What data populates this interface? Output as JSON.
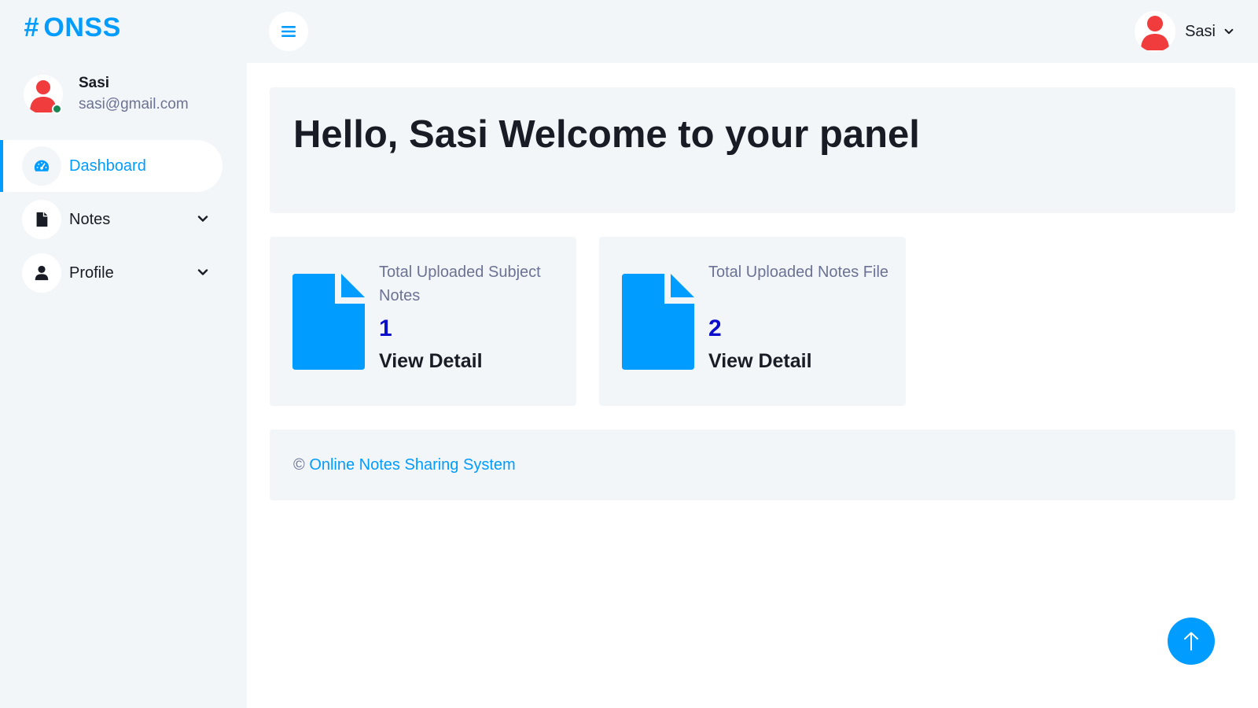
{
  "brand": {
    "hash": "#",
    "name": "ONSS"
  },
  "sidebar": {
    "user": {
      "name": "Sasi",
      "email": "sasi@gmail.com"
    },
    "items": [
      {
        "label": "Dashboard",
        "icon": "gauge-icon",
        "active": true
      },
      {
        "label": "Notes",
        "icon": "file-icon",
        "has_submenu": true
      },
      {
        "label": "Profile",
        "icon": "user-icon",
        "has_submenu": true
      }
    ]
  },
  "topbar": {
    "user_name": "Sasi",
    "menu_icon": "hamburger-icon"
  },
  "welcome": {
    "title": "Hello, Sasi Welcome to your panel"
  },
  "cards": [
    {
      "label": "Total Uploaded Subject Notes",
      "value": "1",
      "link": "View Detail"
    },
    {
      "label": "Total Uploaded Notes File",
      "value": "2",
      "link": "View Detail"
    }
  ],
  "footer": {
    "copyright": "©",
    "link": "Online Notes Sharing System"
  },
  "colors": {
    "accent": "#009cff",
    "sidebar_bg": "#f3f6f9",
    "count_blue": "#0d0dcc",
    "avatar_red": "#f03c3c",
    "online_green": "#198754"
  }
}
